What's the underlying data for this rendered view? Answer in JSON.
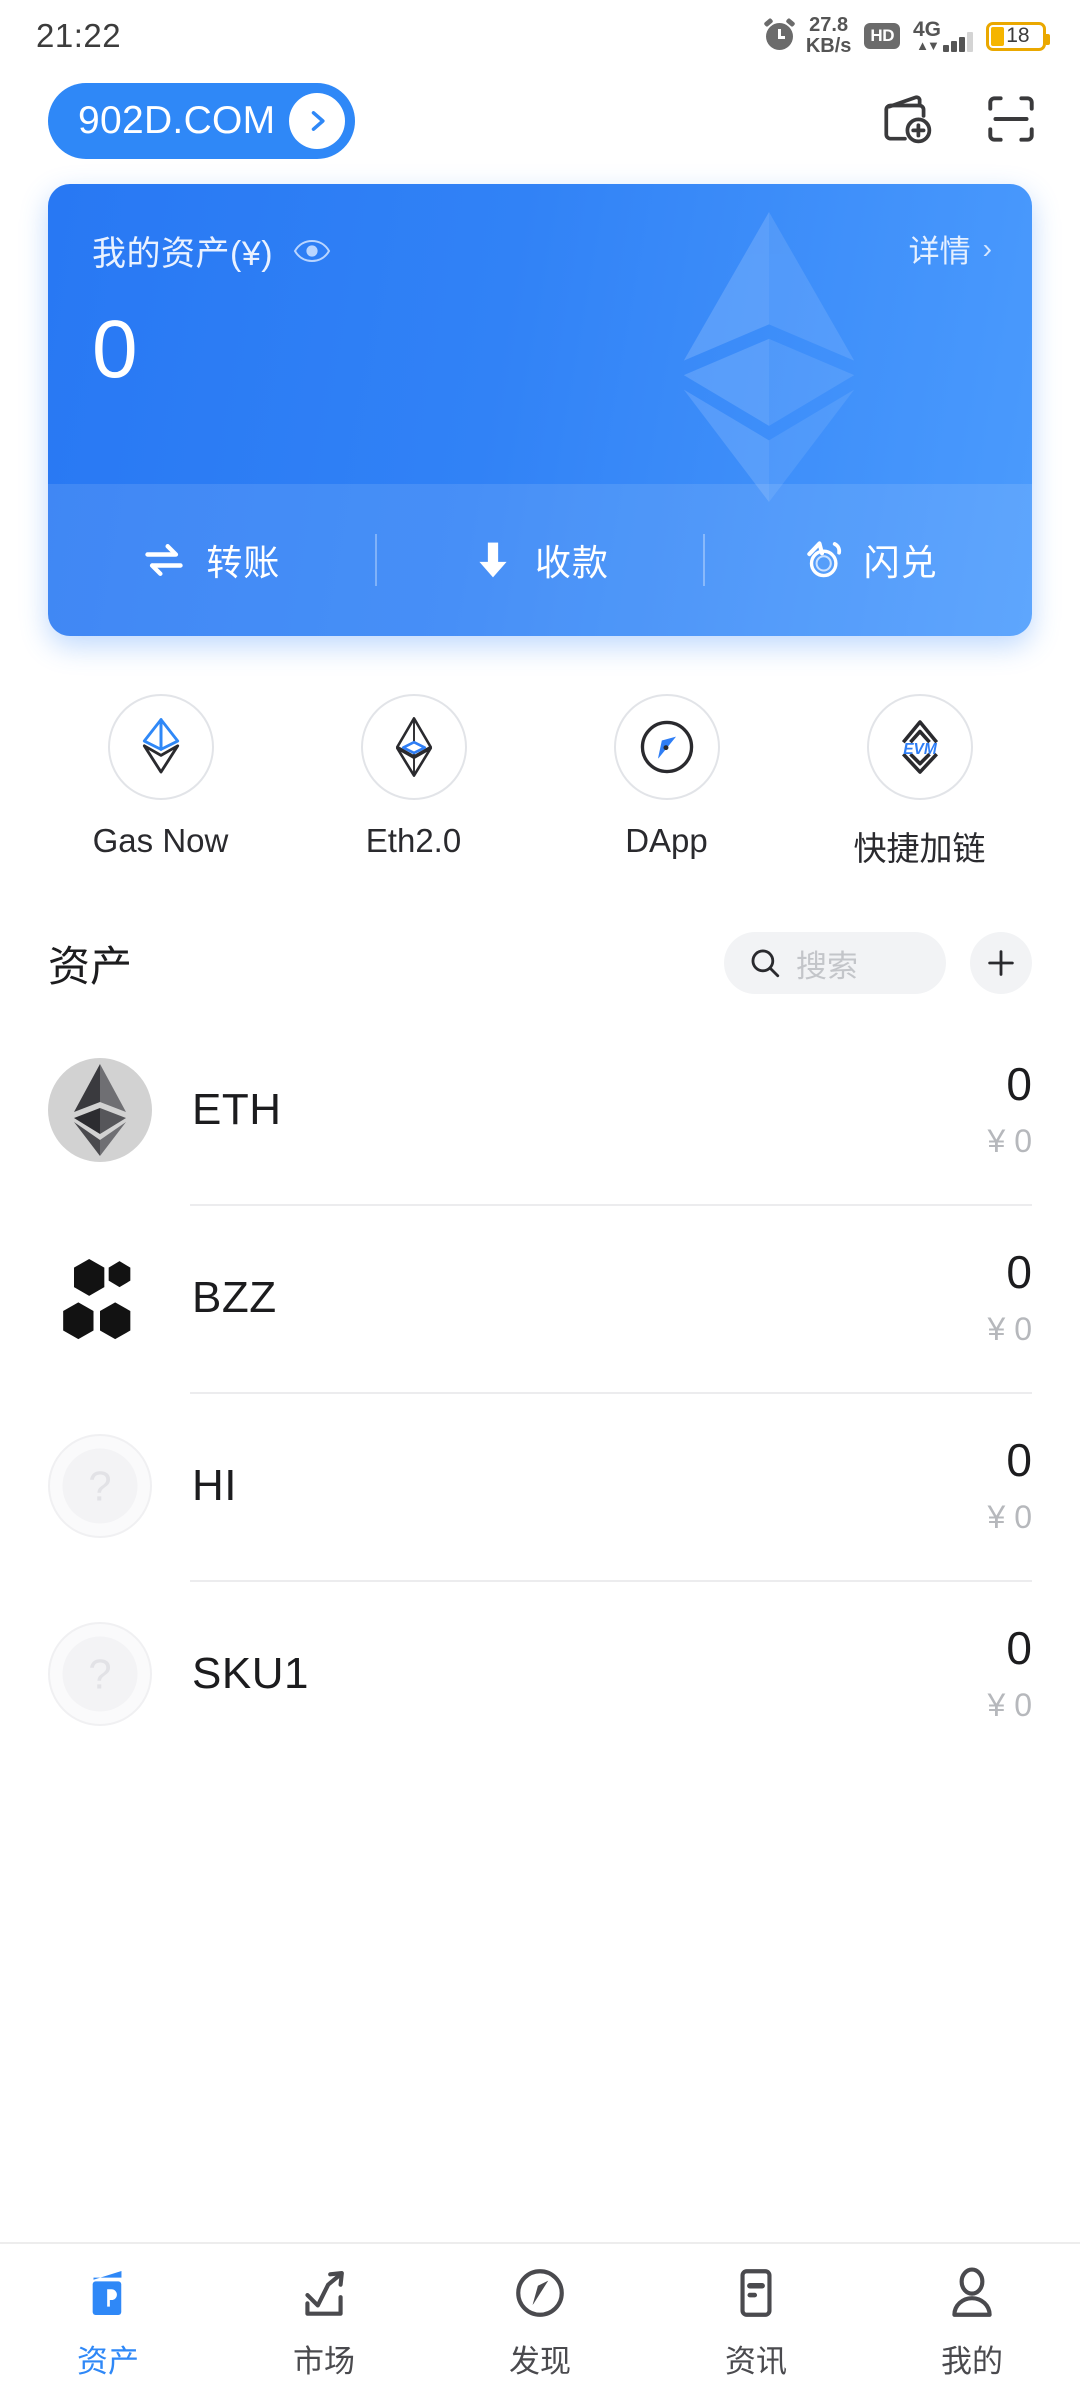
{
  "statusbar": {
    "time": "21:22",
    "alarm_icon": "alarm-clock-icon",
    "net_speed_value": "27.8",
    "net_speed_unit": "KB/s",
    "hd_badge": "HD",
    "network_type": "4G",
    "battery_level": "18"
  },
  "header": {
    "domain_label": "902D.COM",
    "arrow_icon": "chevron-right-icon",
    "wallet_add_icon": "wallet-add-icon",
    "scan_icon": "scan-qr-icon"
  },
  "balance_card": {
    "label": "我的资产(¥)",
    "eye_icon": "eye-icon",
    "amount": "0",
    "detail_label": "详情",
    "detail_chevron": "›",
    "watermark_icon": "ethereum-diamond-watermark",
    "actions": [
      {
        "label": "转账",
        "icon": "transfer-icon"
      },
      {
        "label": "收款",
        "icon": "receive-arrow-down-icon"
      },
      {
        "label": "闪兑",
        "icon": "flash-swap-icon"
      }
    ]
  },
  "shortcuts": [
    {
      "label": "Gas Now",
      "icon": "gas-now-eth-icon"
    },
    {
      "label": "Eth2.0",
      "icon": "eth2-diamond-icon"
    },
    {
      "label": "DApp",
      "icon": "compass-icon"
    },
    {
      "label": "快捷加链",
      "icon": "evm-add-chain-icon"
    }
  ],
  "assets": {
    "title": "资产",
    "search_icon": "search-icon",
    "search_placeholder": "搜索",
    "search_value": "",
    "add_icon": "plus-icon",
    "currency_symbol": "¥",
    "rows": [
      {
        "symbol": "ETH",
        "amount": "0",
        "fiat": "¥ 0",
        "icon": "eth-token-icon"
      },
      {
        "symbol": "BZZ",
        "amount": "0",
        "fiat": "¥ 0",
        "icon": "bzz-token-icon"
      },
      {
        "symbol": "HI",
        "amount": "0",
        "fiat": "¥ 0",
        "icon": "unknown-token-icon"
      },
      {
        "symbol": "SKU1",
        "amount": "0",
        "fiat": "¥ 0",
        "icon": "unknown-token-icon"
      }
    ]
  },
  "tabbar": {
    "items": [
      {
        "label": "资产",
        "icon": "wallet-icon",
        "active": true
      },
      {
        "label": "市场",
        "icon": "chart-icon",
        "active": false
      },
      {
        "label": "发现",
        "icon": "compass-icon",
        "active": false
      },
      {
        "label": "资讯",
        "icon": "news-icon",
        "active": false
      },
      {
        "label": "我的",
        "icon": "person-icon",
        "active": false
      }
    ]
  },
  "colors": {
    "accent": "#2f88f7",
    "card_from": "#2878f3",
    "card_to": "#4b9bfd",
    "battery": "#f5b500",
    "muted": "#b6b8bc"
  }
}
